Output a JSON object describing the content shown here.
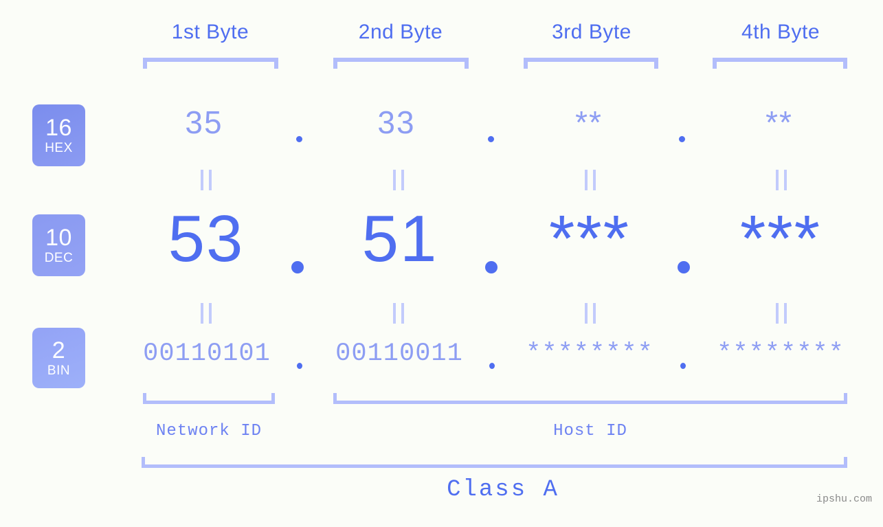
{
  "meta": {
    "watermark": "ipshu.com",
    "background_color": "#fbfdf8",
    "accent_color": "#4f6ef0",
    "accent_light_color": "#8d9df3",
    "bracket_color": "#b2bdfb"
  },
  "byte_headers": [
    {
      "label": "1st Byte"
    },
    {
      "label": "2nd Byte"
    },
    {
      "label": "3rd Byte"
    },
    {
      "label": "4th Byte"
    }
  ],
  "bases": [
    {
      "number": "16",
      "abbr": "HEX"
    },
    {
      "number": "10",
      "abbr": "DEC"
    },
    {
      "number": "2",
      "abbr": "BIN"
    }
  ],
  "rows": {
    "hex": {
      "values": [
        "35",
        "33",
        "**",
        "**"
      ]
    },
    "dec": {
      "values": [
        "53",
        "51",
        "***",
        "***"
      ]
    },
    "bin": {
      "values": [
        "00110101",
        "00110011",
        "********",
        "********"
      ]
    }
  },
  "separator": ".",
  "equals_mark": "=",
  "segments": [
    {
      "label": "Network ID"
    },
    {
      "label": "Host ID"
    }
  ],
  "class": {
    "label": "Class A"
  }
}
